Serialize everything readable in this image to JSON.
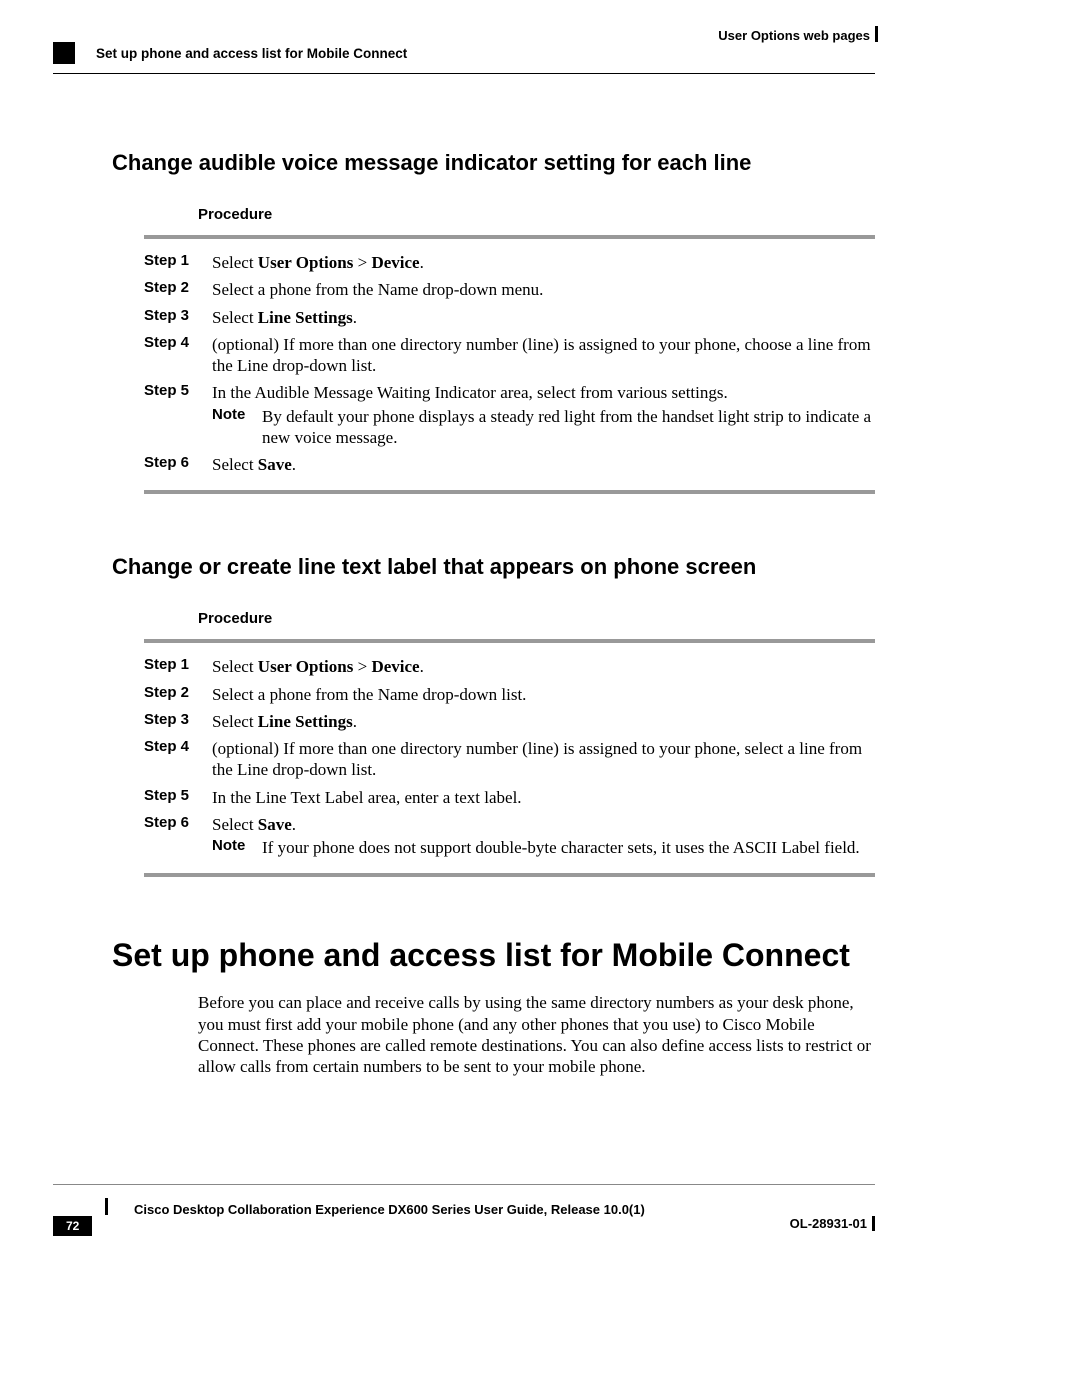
{
  "header": {
    "right": "User Options web pages",
    "left": "Set up phone and access list for Mobile Connect"
  },
  "section1": {
    "title": "Change audible voice message indicator setting for each line",
    "procedure_label": "Procedure",
    "steps": {
      "s1_label": "Step 1",
      "s1_a": "Select ",
      "s1_b": "User Options",
      "s1_c": " > ",
      "s1_d": "Device",
      "s1_e": ".",
      "s2_label": "Step 2",
      "s2": "Select a phone from the Name drop-down menu.",
      "s3_label": "Step 3",
      "s3_a": "Select ",
      "s3_b": "Line Settings",
      "s3_c": ".",
      "s4_label": "Step 4",
      "s4": "(optional) If more than one directory number (line) is assigned to your phone, choose a line from the Line drop-down list.",
      "s5_label": "Step 5",
      "s5": "In the Audible Message Waiting Indicator area, select from various settings.",
      "s5_note_label": "Note",
      "s5_note": "By default your phone displays a steady red light from the handset light strip to indicate a new voice message.",
      "s6_label": "Step 6",
      "s6_a": "Select ",
      "s6_b": "Save",
      "s6_c": "."
    }
  },
  "section2": {
    "title": "Change or create line text label that appears on phone screen",
    "procedure_label": "Procedure",
    "steps": {
      "s1_label": "Step 1",
      "s1_a": "Select ",
      "s1_b": "User Options",
      "s1_c": " > ",
      "s1_d": "Device",
      "s1_e": ".",
      "s2_label": "Step 2",
      "s2": "Select a phone from the Name drop-down list.",
      "s3_label": "Step 3",
      "s3_a": "Select ",
      "s3_b": "Line Settings",
      "s3_c": ".",
      "s4_label": "Step 4",
      "s4": "(optional) If more than one directory number (line) is assigned to your phone, select a line from the Line drop-down list.",
      "s5_label": "Step 5",
      "s5": "In the Line Text Label area, enter a text label.",
      "s6_label": "Step 6",
      "s6_a": "Select ",
      "s6_b": "Save",
      "s6_c": ".",
      "s6_note_label": "Note",
      "s6_note": "If your phone does not support double-byte character sets, it uses the ASCII Label field."
    }
  },
  "chapter": {
    "title": "Set up phone and access list for Mobile Connect",
    "para": "Before you can place and receive calls by using the same directory numbers as your desk phone, you must first add your mobile phone (and any other phones that you use) to Cisco Mobile Connect. These phones are called remote destinations. You can also define access lists to restrict or allow calls from certain numbers to be sent to your mobile phone."
  },
  "footer": {
    "center": "Cisco Desktop Collaboration Experience DX600 Series User Guide, Release 10.0(1)",
    "page": "72",
    "right": "OL-28931-01"
  }
}
